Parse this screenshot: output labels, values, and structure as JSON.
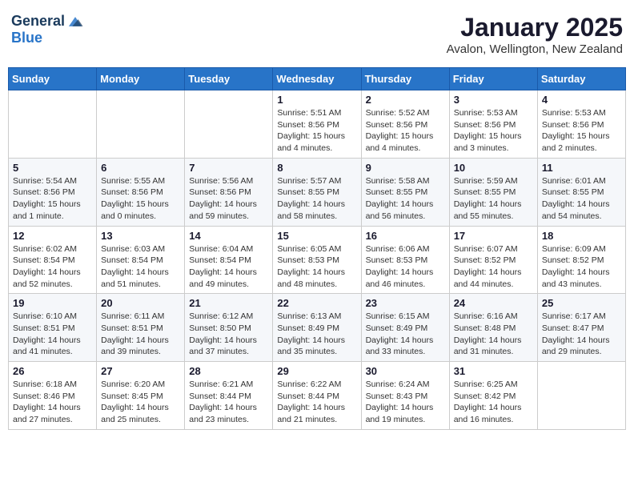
{
  "header": {
    "logo_general": "General",
    "logo_blue": "Blue",
    "month": "January 2025",
    "location": "Avalon, Wellington, New Zealand"
  },
  "weekdays": [
    "Sunday",
    "Monday",
    "Tuesday",
    "Wednesday",
    "Thursday",
    "Friday",
    "Saturday"
  ],
  "weeks": [
    [
      {
        "day": "",
        "info": ""
      },
      {
        "day": "",
        "info": ""
      },
      {
        "day": "",
        "info": ""
      },
      {
        "day": "1",
        "info": "Sunrise: 5:51 AM\nSunset: 8:56 PM\nDaylight: 15 hours\nand 4 minutes."
      },
      {
        "day": "2",
        "info": "Sunrise: 5:52 AM\nSunset: 8:56 PM\nDaylight: 15 hours\nand 4 minutes."
      },
      {
        "day": "3",
        "info": "Sunrise: 5:53 AM\nSunset: 8:56 PM\nDaylight: 15 hours\nand 3 minutes."
      },
      {
        "day": "4",
        "info": "Sunrise: 5:53 AM\nSunset: 8:56 PM\nDaylight: 15 hours\nand 2 minutes."
      }
    ],
    [
      {
        "day": "5",
        "info": "Sunrise: 5:54 AM\nSunset: 8:56 PM\nDaylight: 15 hours\nand 1 minute."
      },
      {
        "day": "6",
        "info": "Sunrise: 5:55 AM\nSunset: 8:56 PM\nDaylight: 15 hours\nand 0 minutes."
      },
      {
        "day": "7",
        "info": "Sunrise: 5:56 AM\nSunset: 8:56 PM\nDaylight: 14 hours\nand 59 minutes."
      },
      {
        "day": "8",
        "info": "Sunrise: 5:57 AM\nSunset: 8:55 PM\nDaylight: 14 hours\nand 58 minutes."
      },
      {
        "day": "9",
        "info": "Sunrise: 5:58 AM\nSunset: 8:55 PM\nDaylight: 14 hours\nand 56 minutes."
      },
      {
        "day": "10",
        "info": "Sunrise: 5:59 AM\nSunset: 8:55 PM\nDaylight: 14 hours\nand 55 minutes."
      },
      {
        "day": "11",
        "info": "Sunrise: 6:01 AM\nSunset: 8:55 PM\nDaylight: 14 hours\nand 54 minutes."
      }
    ],
    [
      {
        "day": "12",
        "info": "Sunrise: 6:02 AM\nSunset: 8:54 PM\nDaylight: 14 hours\nand 52 minutes."
      },
      {
        "day": "13",
        "info": "Sunrise: 6:03 AM\nSunset: 8:54 PM\nDaylight: 14 hours\nand 51 minutes."
      },
      {
        "day": "14",
        "info": "Sunrise: 6:04 AM\nSunset: 8:54 PM\nDaylight: 14 hours\nand 49 minutes."
      },
      {
        "day": "15",
        "info": "Sunrise: 6:05 AM\nSunset: 8:53 PM\nDaylight: 14 hours\nand 48 minutes."
      },
      {
        "day": "16",
        "info": "Sunrise: 6:06 AM\nSunset: 8:53 PM\nDaylight: 14 hours\nand 46 minutes."
      },
      {
        "day": "17",
        "info": "Sunrise: 6:07 AM\nSunset: 8:52 PM\nDaylight: 14 hours\nand 44 minutes."
      },
      {
        "day": "18",
        "info": "Sunrise: 6:09 AM\nSunset: 8:52 PM\nDaylight: 14 hours\nand 43 minutes."
      }
    ],
    [
      {
        "day": "19",
        "info": "Sunrise: 6:10 AM\nSunset: 8:51 PM\nDaylight: 14 hours\nand 41 minutes."
      },
      {
        "day": "20",
        "info": "Sunrise: 6:11 AM\nSunset: 8:51 PM\nDaylight: 14 hours\nand 39 minutes."
      },
      {
        "day": "21",
        "info": "Sunrise: 6:12 AM\nSunset: 8:50 PM\nDaylight: 14 hours\nand 37 minutes."
      },
      {
        "day": "22",
        "info": "Sunrise: 6:13 AM\nSunset: 8:49 PM\nDaylight: 14 hours\nand 35 minutes."
      },
      {
        "day": "23",
        "info": "Sunrise: 6:15 AM\nSunset: 8:49 PM\nDaylight: 14 hours\nand 33 minutes."
      },
      {
        "day": "24",
        "info": "Sunrise: 6:16 AM\nSunset: 8:48 PM\nDaylight: 14 hours\nand 31 minutes."
      },
      {
        "day": "25",
        "info": "Sunrise: 6:17 AM\nSunset: 8:47 PM\nDaylight: 14 hours\nand 29 minutes."
      }
    ],
    [
      {
        "day": "26",
        "info": "Sunrise: 6:18 AM\nSunset: 8:46 PM\nDaylight: 14 hours\nand 27 minutes."
      },
      {
        "day": "27",
        "info": "Sunrise: 6:20 AM\nSunset: 8:45 PM\nDaylight: 14 hours\nand 25 minutes."
      },
      {
        "day": "28",
        "info": "Sunrise: 6:21 AM\nSunset: 8:44 PM\nDaylight: 14 hours\nand 23 minutes."
      },
      {
        "day": "29",
        "info": "Sunrise: 6:22 AM\nSunset: 8:44 PM\nDaylight: 14 hours\nand 21 minutes."
      },
      {
        "day": "30",
        "info": "Sunrise: 6:24 AM\nSunset: 8:43 PM\nDaylight: 14 hours\nand 19 minutes."
      },
      {
        "day": "31",
        "info": "Sunrise: 6:25 AM\nSunset: 8:42 PM\nDaylight: 14 hours\nand 16 minutes."
      },
      {
        "day": "",
        "info": ""
      }
    ]
  ]
}
